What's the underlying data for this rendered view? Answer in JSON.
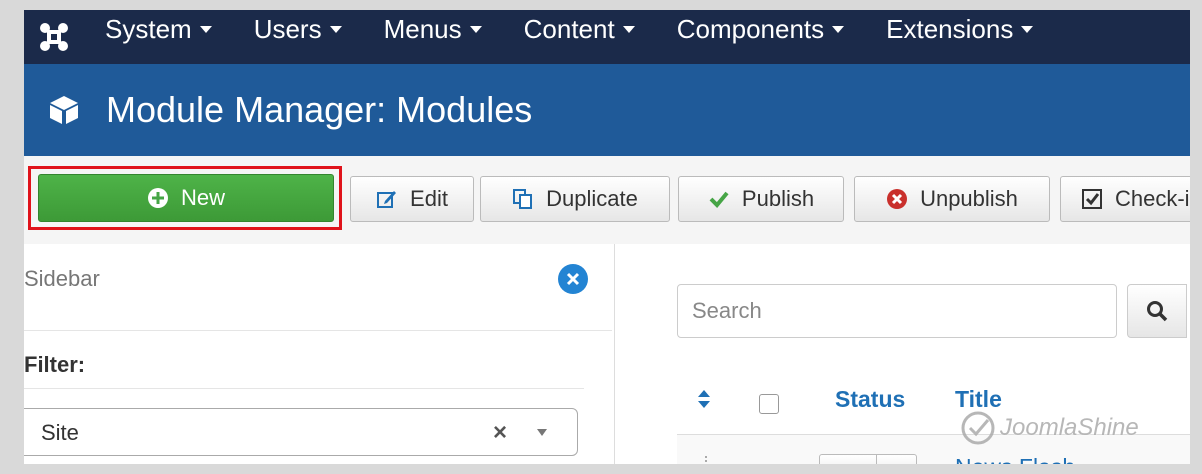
{
  "topnav": {
    "logo_icon": "joomla-logo-icon",
    "items": [
      {
        "label": "System"
      },
      {
        "label": "Users"
      },
      {
        "label": "Menus"
      },
      {
        "label": "Content"
      },
      {
        "label": "Components"
      },
      {
        "label": "Extensions"
      }
    ]
  },
  "header": {
    "icon": "cube-icon",
    "title": "Module Manager: Modules"
  },
  "toolbar": {
    "new_label": "New",
    "edit_label": "Edit",
    "duplicate_label": "Duplicate",
    "publish_label": "Publish",
    "unpublish_label": "Unpublish",
    "checkin_label": "Check-in"
  },
  "sidebar": {
    "heading": "Sidebar",
    "filter_label": "Filter:",
    "site_select_value": "Site"
  },
  "main": {
    "search_placeholder": "Search",
    "columns": {
      "status": "Status",
      "title": "Title"
    },
    "rows": [
      {
        "title": "News Flash"
      }
    ]
  },
  "watermark": {
    "text": "JoomlaShine"
  },
  "colors": {
    "nav_bg": "#1b2a4a",
    "header_bg": "#1f5a99",
    "new_button": "#46a546",
    "highlight_border": "#e0131b",
    "link_blue": "#1f70b5"
  }
}
